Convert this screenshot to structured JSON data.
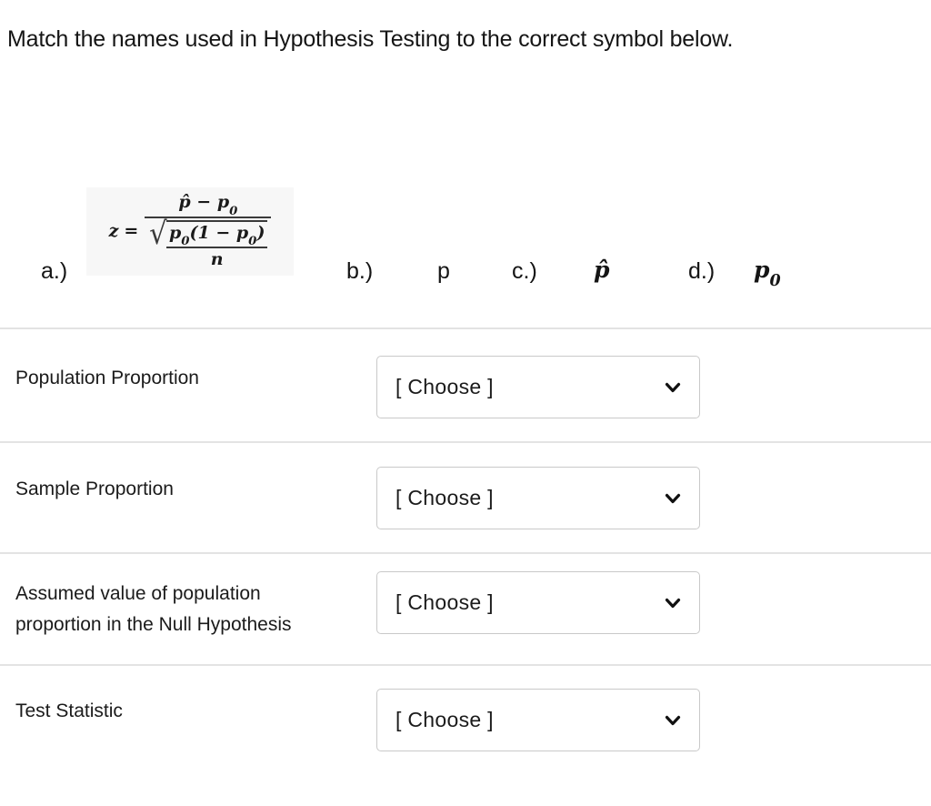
{
  "question": {
    "prompt": "Match the names used in Hypothesis Testing to the correct symbol below."
  },
  "options": [
    {
      "label": "a.)",
      "type": "formula",
      "symbol": "z = (p̂ − p₀) / √(p₀(1 − p₀)/n)",
      "formula_parts": {
        "lhs": "z",
        "equals": "=",
        "numerator_left": "p̂",
        "numerator_minus": "−",
        "numerator_right_base": "p",
        "numerator_right_sub": "0",
        "radical": "√",
        "inner_num_left_base": "p",
        "inner_num_left_sub": "0",
        "inner_num_paren_open": "(1 − ",
        "inner_num_right_base": "p",
        "inner_num_right_sub": "0",
        "inner_num_paren_close": ")",
        "inner_den": "n"
      }
    },
    {
      "label": "b.)",
      "type": "symbol",
      "symbol": "p"
    },
    {
      "label": "c.)",
      "type": "symbol",
      "symbol": "p̂"
    },
    {
      "label": "d.)",
      "type": "symbol",
      "symbol": "p",
      "symbol_sub": "0"
    }
  ],
  "matching": {
    "rows": [
      {
        "term": "Population Proportion",
        "term_line2": "",
        "dropdown_value": "[ Choose ]"
      },
      {
        "term": "Sample Proportion",
        "term_line2": "",
        "dropdown_value": "[ Choose ]"
      },
      {
        "term": "Assumed value of population",
        "term_line2": "proportion in the Null Hypothesis",
        "dropdown_value": "[ Choose ]"
      },
      {
        "term": "Test Statistic",
        "term_line2": "",
        "dropdown_value": "[ Choose ]"
      }
    ],
    "dropdown_icon": "chevron-down-icon"
  },
  "colors": {
    "text": "#1b1b1b",
    "divider": "#e3e3e3",
    "dropdown_border": "#c9c9c9",
    "formula_background": "#f7f7f7",
    "page_background": "#ffffff"
  }
}
